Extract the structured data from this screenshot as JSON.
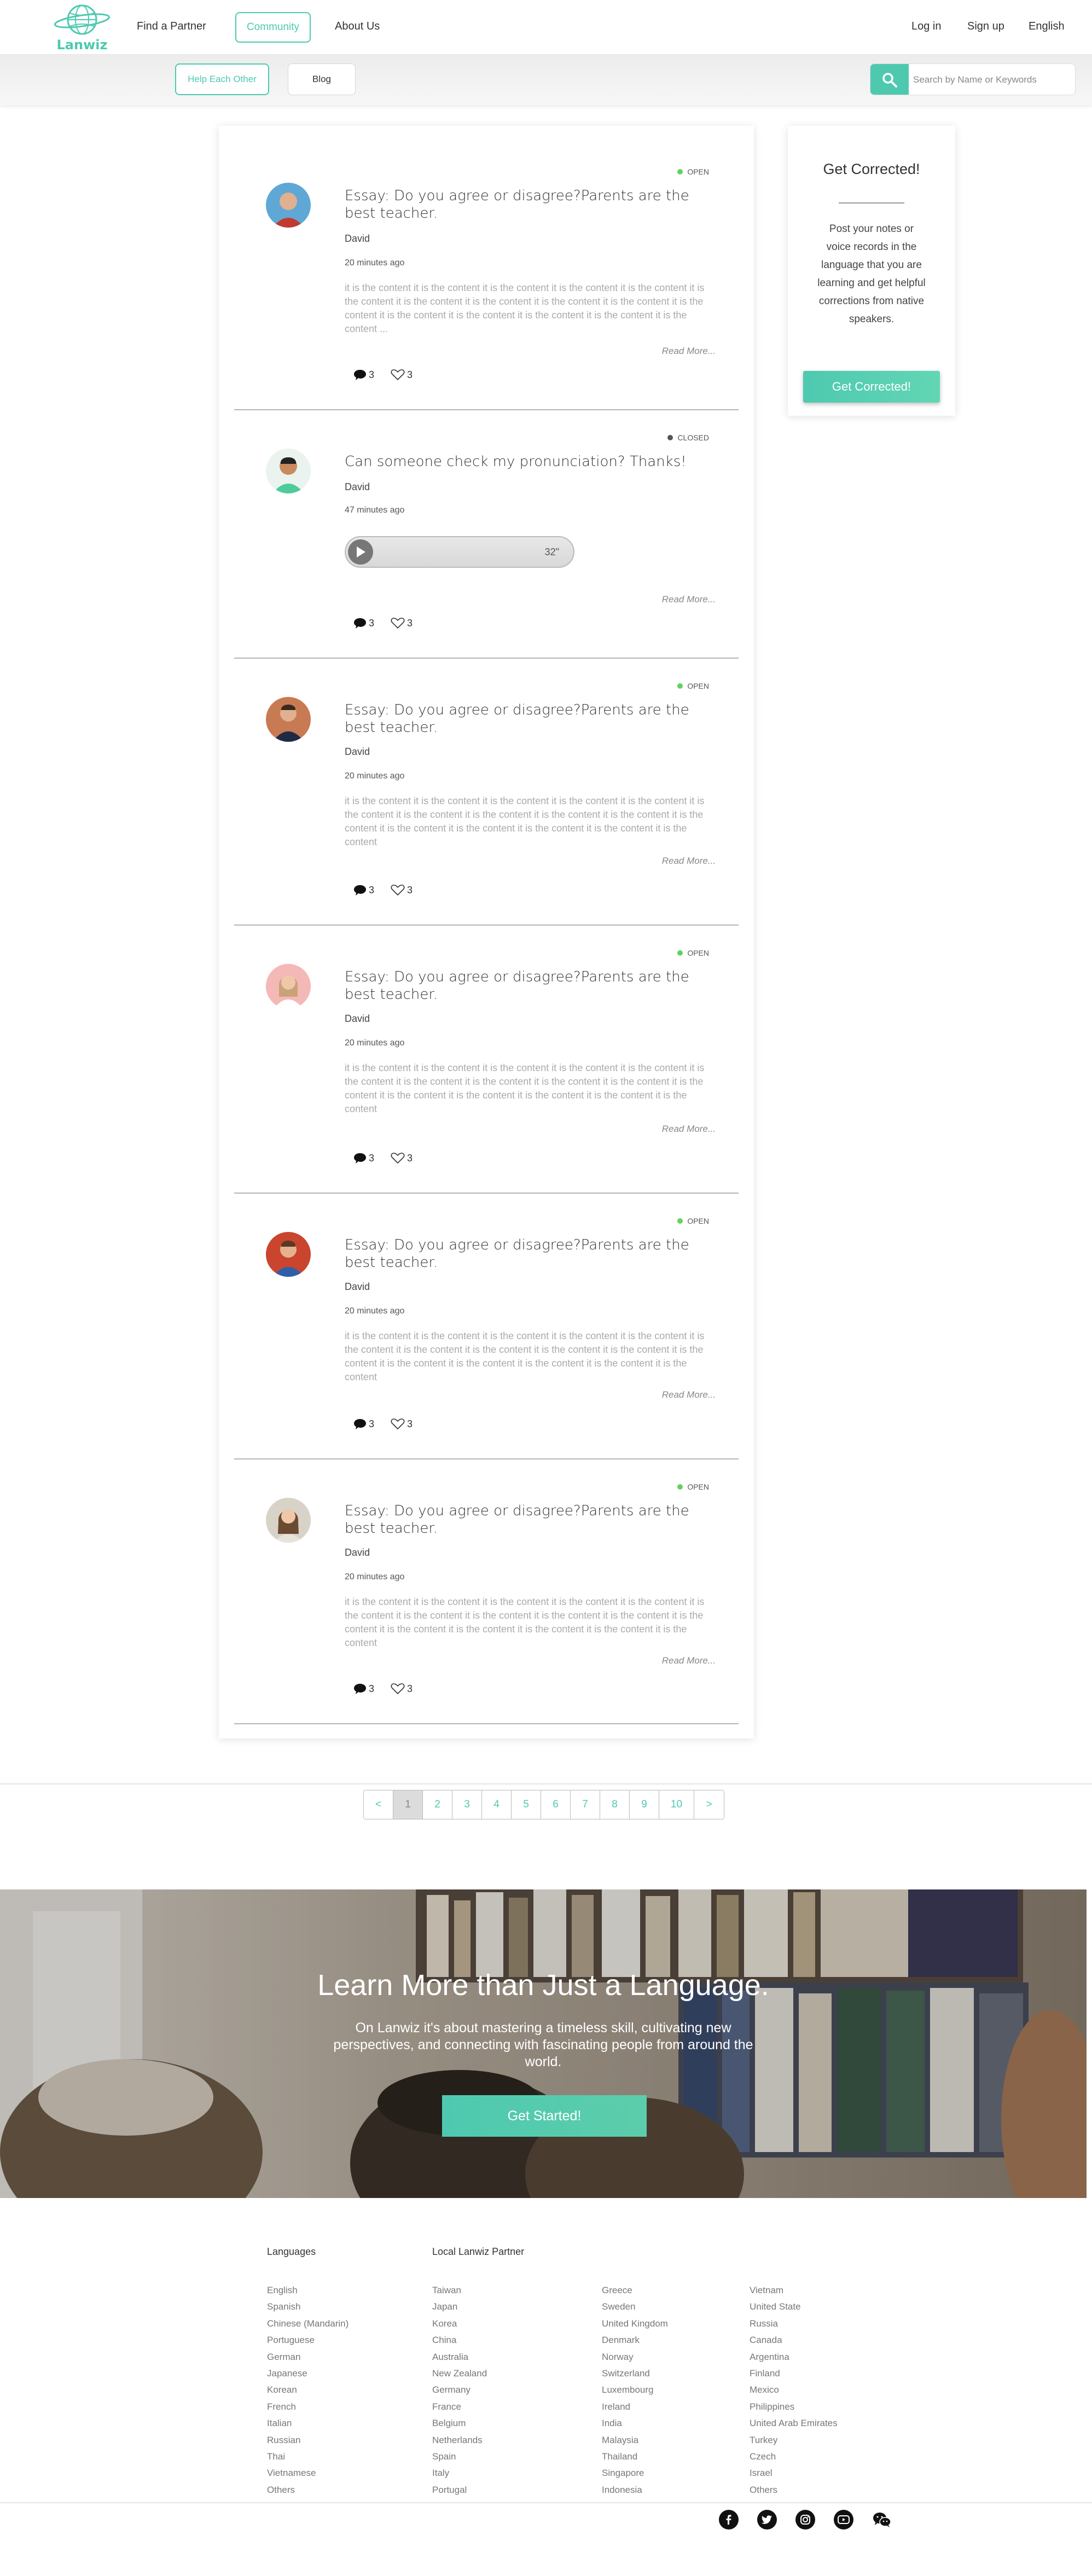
{
  "nav": {
    "logo_text": "Lanwiz",
    "links": [
      "Find a Partner",
      "Community",
      "About Us"
    ],
    "right_links": [
      "Log in",
      "Sign up",
      "English"
    ]
  },
  "subnav": {
    "tabs": [
      "Help Each Other",
      "Blog"
    ],
    "search_placeholder": "Search by Name or Keywords"
  },
  "posts": [
    {
      "status": "OPEN",
      "title": "Essay: Do you agree or disagree?Parents are the best teacher.",
      "author": "David",
      "time": "20 minutes ago",
      "excerpt": "it is the content it is the content it is the content it is the content it is the content it is the content it is the content it is the content it is the content it is the content it is the content it is the content it is the content it is the content it is the content it is the content ...",
      "read_more": "Read More...",
      "comments": "3",
      "likes": "3"
    },
    {
      "status": "CLOSED",
      "title": "Can someone check my pronunciation? Thanks!",
      "author": "David",
      "time": "47 minutes ago",
      "audio_duration": "32\"",
      "read_more": "Read More...",
      "comments": "3",
      "likes": "3"
    },
    {
      "status": "OPEN",
      "title": "Essay: Do you agree or disagree?Parents are the best teacher.",
      "author": "David",
      "time": "20 minutes ago",
      "excerpt": "it is the content it is the content it is the content it is the content it is the content it is the content it is the content it is the content it is the content it is the content it is the content it is the content it is the content it is the content it is the content it is the content",
      "read_more": "Read More...",
      "comments": "3",
      "likes": "3"
    },
    {
      "status": "OPEN",
      "title": "Essay: Do you agree or disagree?Parents are the best teacher.",
      "author": "David",
      "time": "20 minutes ago",
      "excerpt": "it is the content it is the content it is the content it is the content it is the content it is the content it is the content it is the content it is the content it is the content it is the content it is the content it is the content it is the content it is the content it is the content",
      "read_more": "Read More...",
      "comments": "3",
      "likes": "3"
    },
    {
      "status": "OPEN",
      "title": "Essay: Do you agree or disagree?Parents are the best teacher.",
      "author": "David",
      "time": "20 minutes ago",
      "excerpt": "it is the content it is the content it is the content it is the content it is the content it is the content it is the content it is the content it is the content it is the content it is the content it is the content it is the content it is the content it is the content it is the content",
      "read_more": "Read More...",
      "comments": "3",
      "likes": "3"
    },
    {
      "status": "OPEN",
      "title": "Essay: Do you agree or disagree?Parents are the best teacher.",
      "author": "David",
      "time": "20 minutes ago",
      "excerpt": "it is the content it is the content it is the content it is the content it is the content it is the content it is the content it is the content it is the content it is the content it is the content it is the content it is the content it is the content it is the content it is the content",
      "read_more": "Read More...",
      "comments": "3",
      "likes": "3"
    }
  ],
  "sidebar": {
    "title": "Get Corrected!",
    "text": "Post your notes or voice records in the language that you are learning and get helpful corrections from native speakers.",
    "button": "Get Corrected!"
  },
  "pagination": {
    "prev": "<",
    "next": ">",
    "pages": [
      "1",
      "2",
      "3",
      "4",
      "5",
      "6",
      "7",
      "8",
      "9",
      "10"
    ]
  },
  "hero": {
    "title": "Learn More than Just a Language.",
    "text": "On Lanwiz it's about mastering a timeless skill, cultivating new perspectives, and connecting with fascinating people from around the world.",
    "button": "Get Started!"
  },
  "footer": {
    "languages_heading": "Languages",
    "languages": [
      "English",
      "Spanish",
      "Chinese (Mandarin)",
      "Portuguese",
      "German",
      "Japanese",
      "Korean",
      "French",
      "Italian",
      "Russian",
      "Thai",
      "Vietnamese",
      "Others"
    ],
    "partner_heading": "Local Lanwiz Partner",
    "partners_col1": [
      "Taiwan",
      "Japan",
      "Korea",
      "China",
      "Australia",
      "New Zealand",
      "Germany",
      "France",
      "Belgium",
      "Netherlands",
      "Spain",
      "Italy",
      "Portugal"
    ],
    "partners_col2": [
      "Greece",
      "Sweden",
      "United Kingdom",
      "Denmark",
      "Norway",
      "Switzerland",
      "Luxembourg",
      "Ireland",
      "India",
      "Malaysia",
      "Thailand",
      "Singapore",
      "Indonesia"
    ],
    "partners_col3": [
      "Vietnam",
      "United State",
      "Russia",
      "Canada",
      "Argentina",
      "Finland",
      "Mexico",
      "Philippines",
      "United Arab Emirates",
      "Turkey",
      "Czech",
      "Israel",
      "Others"
    ],
    "social_icons": [
      "facebook-icon",
      "twitter-icon",
      "instagram-icon",
      "youtube-icon",
      "wechat-icon"
    ]
  },
  "colors": {
    "accent": "#4ec9b0",
    "open_dot": "#5fd35f",
    "closed_dot": "#555555"
  }
}
